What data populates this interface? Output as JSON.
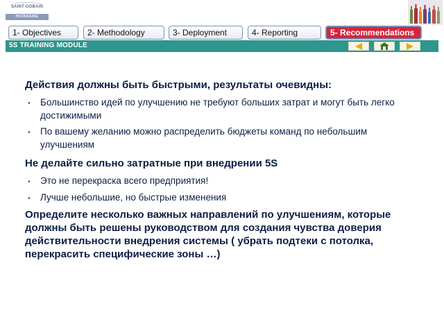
{
  "logo": {
    "brand": "SAINT-GOBAIN",
    "sub": "PACKAGING"
  },
  "tabs": [
    {
      "label": "1- Objectives",
      "active": false
    },
    {
      "label": "2- Methodology",
      "active": false
    },
    {
      "label": "3- Deployment",
      "active": false
    },
    {
      "label": "4- Reporting",
      "active": false
    },
    {
      "label": "5- Recommendations",
      "active": true
    }
  ],
  "module": {
    "title": "5S TRAINING MODULE",
    "nav": [
      "arrow-left-icon",
      "home-icon",
      "arrow-right-icon"
    ]
  },
  "colors": {
    "teal_bar": "#2f968f",
    "active_tab": "#d7253a",
    "text": "#0c1e45",
    "nav_arrow": "#e4ad0f",
    "home_icon": "#4e6f2a"
  },
  "sections": [
    {
      "heading": "Действия должны быть быстрыми, результаты очевидны:",
      "bullets": [
        "Большинство идей по улучшению не требуют больших затрат и могут быть легко достижимыми",
        "По вашему желанию можно распределить бюджеты команд по небольшим улучшениям"
      ]
    },
    {
      "heading": "Не делайте сильно затратные при внедрении 5S",
      "bullets": [
        "Это не перекраска всего предприятия!",
        "Лучше небольшие, но быстрые изменения"
      ]
    },
    {
      "heading": "Определите несколько важных направлений по улучшениям, которые должны быть решены руководством для создания чувства доверия действительности внедрения системы ( убрать подтеки с потолка, перекрасить специфические зоны …)",
      "bullets": []
    }
  ],
  "bullet_marker": "•"
}
